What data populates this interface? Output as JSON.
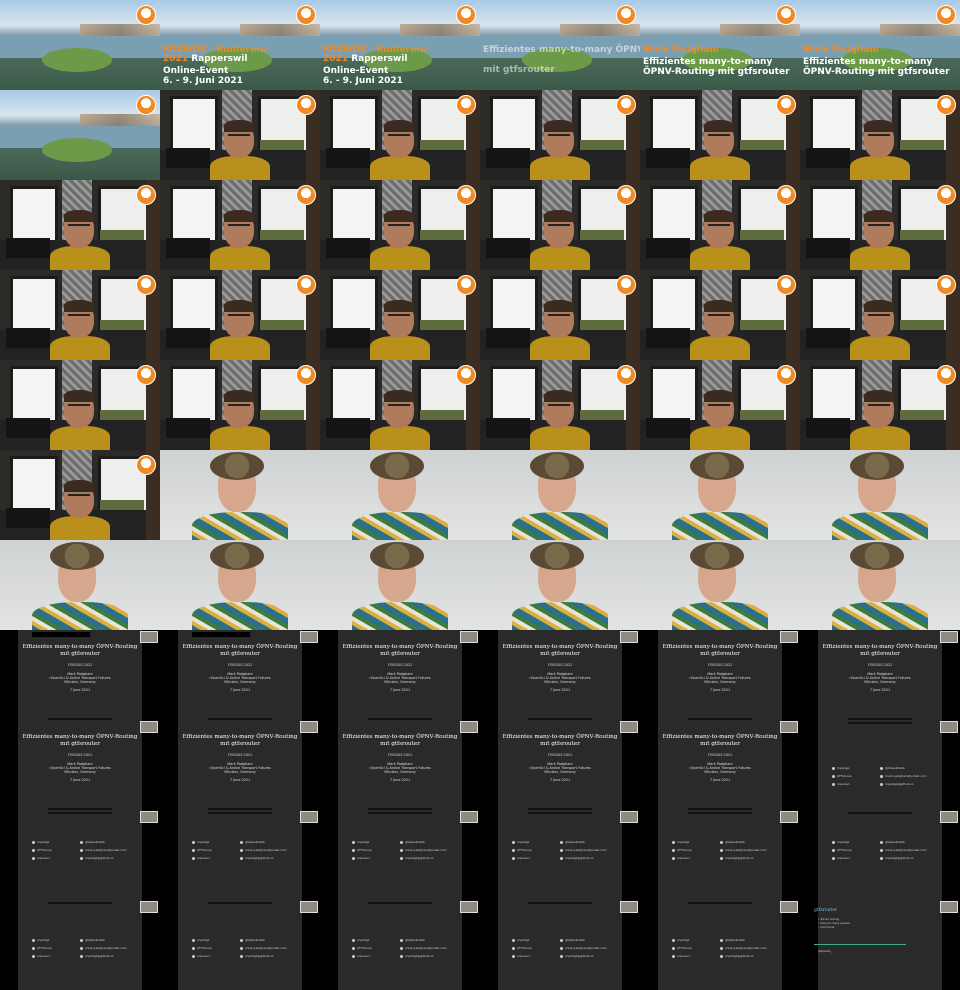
{
  "title_frames": {
    "conference": "FOSSGIS - Konferenz",
    "year": "2021",
    "location": "Rapperswil",
    "event": "Online-Event",
    "dates": "6. - 9. Juni 2021",
    "speaker": "Mark Padgham",
    "talk": "Effizientes many-to-many ÖPNV-Routing mit gtfsrouter"
  },
  "slides": {
    "title": "Effizientes many-to-many ÖPNV-Routing mit gtfsrouter",
    "event": "FOSSGIS 2021",
    "author": "Mark Padgham",
    "affiliation": "rOpenSci & Active Transport Futures",
    "city": "Münster, Germany",
    "date": "7 June 2021",
    "links_left": [
      "mpadge",
      "ATFutures",
      "ropensci"
    ],
    "links_right": [
      "@bikesRdata",
      "mark.padgham@email.com",
      "mpadge@github.io"
    ],
    "section_heading": "gtfsrouter",
    "bullets": [
      "Transit routing",
      "many-to-many queries",
      "isochrones"
    ],
    "footer": "gtfsrouter_"
  },
  "colors": {
    "accent": "#f08a24",
    "slide_bg": "#2a2a2a",
    "link_blue": "#6cc2e8"
  },
  "grid": {
    "columns": 6,
    "rows": 11
  }
}
